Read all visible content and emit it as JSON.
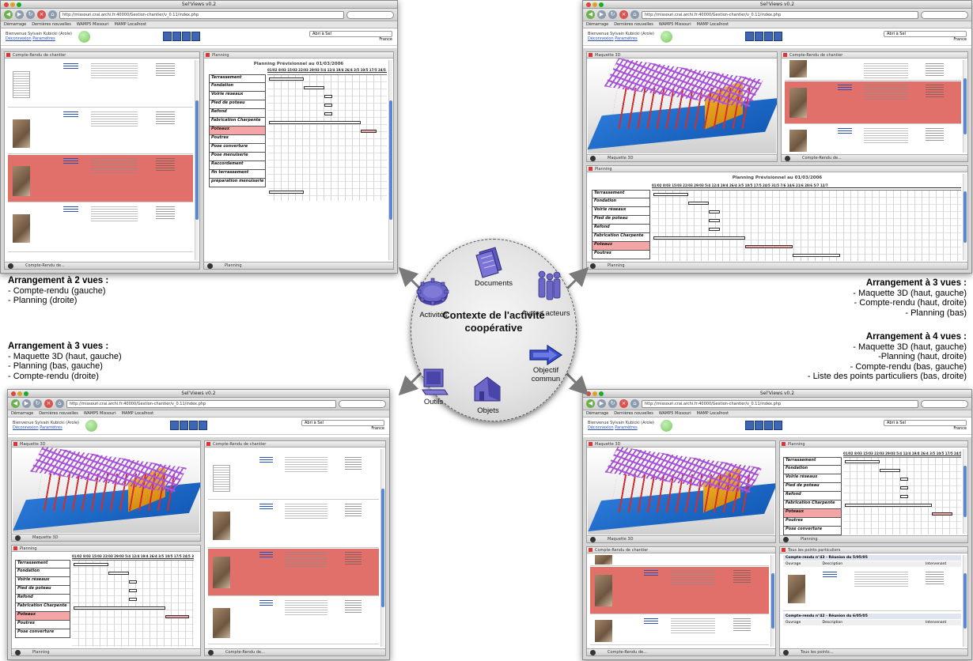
{
  "app": {
    "window_title": "Sel'Views v0.2",
    "url": "http://missouri.crai.archi.fr:40000/Gestion-chantier/v_0.11/index.php",
    "bookmarks": [
      "Démarrage",
      "Dernières nouvelles",
      "WAMP5 Missouri",
      "MAMP Localhost"
    ],
    "user_line1": "Bienvenue Sylvain Kubicki (Arole)",
    "user_links": [
      "Déconnexion",
      "Paramètres"
    ],
    "project": "Abri à Sel",
    "country": "France"
  },
  "panels": {
    "compte_rendu": "Compte-Rendu de chantier",
    "compte_rendu_foot": "Compte-Rendu de...",
    "planning": "Planning",
    "maquette": "Maquette 3D",
    "points": "Tous les points particuliers",
    "points_foot": "Tous les points..."
  },
  "gantt": {
    "title": "Planning Prévisionnel au 01/03/2006",
    "dates": "01/02 8/03 15/03 22/03 29/03 5/4 12/4 19/4 26/4 3/5 10/5 17/5 24/5 31/5 7/6 14/6 21/6 28/6 5/7 12/7",
    "tasks": [
      "Terrassement",
      "Fondation",
      "Voirie réseaux",
      "Pied de poteau",
      "Refond",
      "Fabrication Charpente",
      "Poteaux",
      "Poutres",
      "Pose converture",
      "Pose menuiserie",
      "Raccordement",
      "fin terrassement",
      "préparation menuiserie"
    ],
    "highlighted_task": "Poteaux"
  },
  "compte_rendu_items": {
    "links": [
      "Plans",
      "Chassis",
      "Poteaux",
      "Massifs de fondation"
    ],
    "source_label": "Source :",
    "concerned_label": "Concernés :"
  },
  "points_table": {
    "header1": "Compte-rendu n°43 - Réunion du 5/05/05",
    "header2": "Compte-rendu n°42 - Réunion du 6/05/05",
    "columns": [
      "Ouvrage",
      "Description",
      "Intervenant"
    ]
  },
  "captions": {
    "top_left": {
      "heading": "Arrangement à 2 vues :",
      "lines": [
        "- Compte-rendu (gauche)",
        "- Planning (droite)"
      ]
    },
    "mid_left": {
      "heading": "Arrangement à 3 vues :",
      "lines": [
        "- Maquette 3D (haut, gauche)",
        "- Planning (bas, gauche)",
        "- Compte-rendu (droite)"
      ]
    },
    "top_right": {
      "heading": "Arrangement à 3 vues :",
      "lines": [
        "- Maquette 3D (haut, gauche)",
        "- Compte-rendu (haut, droite)",
        "- Planning (bas)"
      ]
    },
    "mid_right": {
      "heading": "Arrangement à 4 vues :",
      "lines": [
        "- Maquette 3D (haut, gauche)",
        "-Planning (haut, droite)",
        "- Compte-rendu (bas, gauche)",
        "- Liste des points particuliers (bas, droite)"
      ]
    }
  },
  "context": {
    "title_line1": "Contexte de l'activité",
    "title_line2": "coopérative",
    "documents": "Documents",
    "activites": "Activités",
    "autres_acteurs": "Autres acteurs",
    "outils": "Outils",
    "objets": "Objets",
    "objectif_line1": "Objectif",
    "objectif_line2": "commun",
    "icon_color": "#6b66c8"
  }
}
